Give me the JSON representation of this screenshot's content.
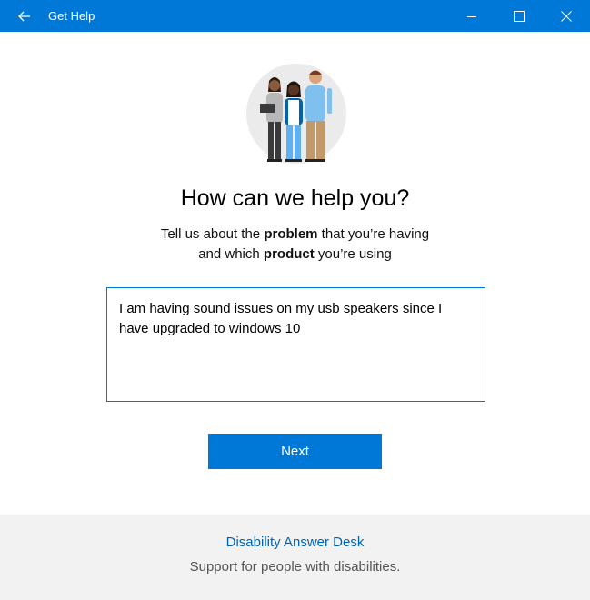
{
  "window": {
    "title": "Get Help"
  },
  "main": {
    "heading": "How can we help you?",
    "subtext": {
      "line1_pre": "Tell us about the ",
      "line1_bold": "problem",
      "line1_post": " that you’re having",
      "line2_pre": "and which ",
      "line2_bold": "product",
      "line2_post": " you’re using"
    },
    "input_value": "I am having sound issues on my usb speakers since I have upgraded to windows 10",
    "next_label": "Next"
  },
  "footer": {
    "link_label": "Disability Answer Desk",
    "description": "Support for people with disabilities."
  },
  "colors": {
    "accent": "#0078d7",
    "link": "#0063b1",
    "footer_bg": "#f2f2f2"
  },
  "icons": [
    "back-arrow-icon",
    "minimize-icon",
    "maximize-icon",
    "close-icon",
    "support-people-illustration"
  ]
}
